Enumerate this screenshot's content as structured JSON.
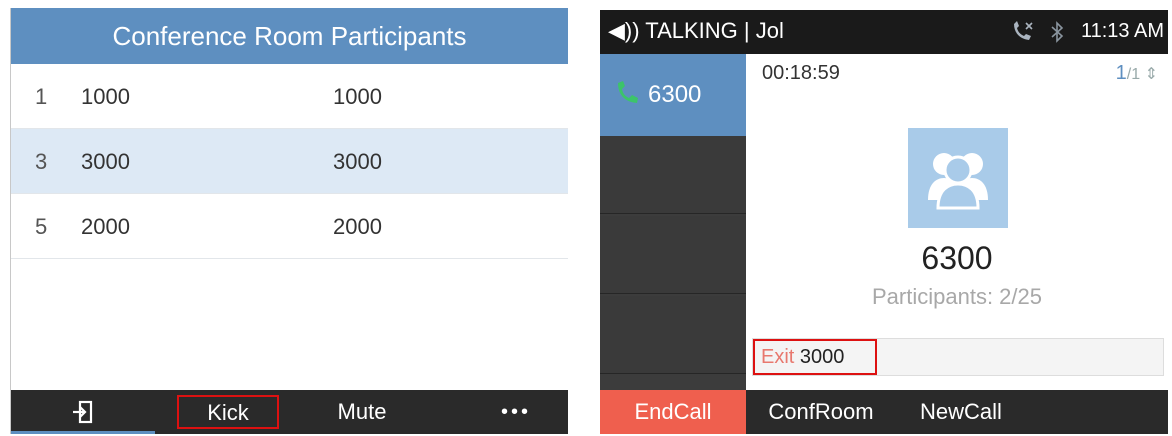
{
  "left": {
    "title": "Conference Room Participants",
    "rows": [
      {
        "index": "1",
        "number": "1000",
        "name": "1000",
        "selected": false
      },
      {
        "index": "3",
        "number": "3000",
        "name": "3000",
        "selected": true
      },
      {
        "index": "5",
        "number": "2000",
        "name": "2000",
        "selected": false
      }
    ],
    "softkeys": {
      "back_icon": "exit-icon",
      "kick": "Kick",
      "mute": "Mute",
      "more": "•••"
    }
  },
  "right": {
    "status": {
      "title": "◀)) TALKING | Jol",
      "time": "11:13 AM",
      "icons": [
        "call-forward-icon",
        "bluetooth-icon"
      ]
    },
    "line": {
      "extension": "6300",
      "icon": "phone-icon"
    },
    "call": {
      "timer": "00:18:59",
      "page_current": "1",
      "page_total": "/1",
      "name": "6300",
      "participants": "Participants: 2/25",
      "hint_exit": "Exit",
      "hint_ext": "3000"
    },
    "softkeys": {
      "endcall": "EndCall",
      "confroom": "ConfRoom",
      "newcall": "NewCall"
    }
  },
  "colors": {
    "accent_blue": "#5e8fc0",
    "selected_row": "#dde9f5",
    "endcall_red": "#ef5f4e",
    "highlight_red": "#dd1111"
  }
}
